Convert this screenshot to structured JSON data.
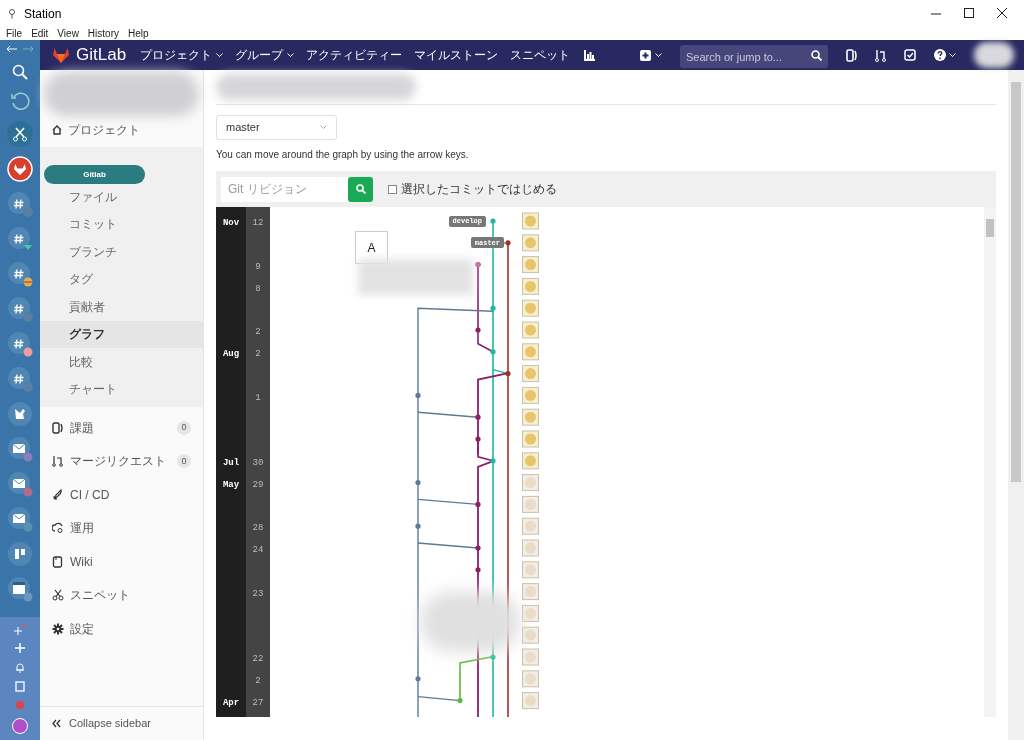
{
  "window": {
    "title": "Station"
  },
  "menu": [
    "File",
    "Edit",
    "View",
    "History",
    "Help"
  ],
  "navbar": {
    "logo": "GitLab",
    "items": [
      {
        "label": "プロジェクト",
        "dropdown": true
      },
      {
        "label": "グループ",
        "dropdown": true
      },
      {
        "label": "アクティビティー",
        "dropdown": false
      },
      {
        "label": "マイルストーン",
        "dropdown": false
      },
      {
        "label": "スニペット",
        "dropdown": false
      }
    ],
    "search": {
      "placeholder": "Search or jump to..."
    }
  },
  "sidebar": {
    "project": "プロジェクト",
    "tooltip": "Gitlab",
    "repo_items": [
      {
        "label": "ファイル",
        "selected": false
      },
      {
        "label": "コミット",
        "selected": false
      },
      {
        "label": "ブランチ",
        "selected": false
      },
      {
        "label": "タグ",
        "selected": false
      },
      {
        "label": "貢献者",
        "selected": false
      },
      {
        "label": "グラフ",
        "selected": true
      },
      {
        "label": "比較",
        "selected": false
      },
      {
        "label": "チャート",
        "selected": false
      }
    ],
    "items": [
      {
        "label": "課題",
        "count": "0"
      },
      {
        "label": "マージリクエスト",
        "count": "0"
      },
      {
        "label": "CI / CD"
      },
      {
        "label": "運用"
      },
      {
        "label": "Wiki"
      },
      {
        "label": "スニペット"
      },
      {
        "label": "設定"
      }
    ],
    "collapse": "Collapse sidebar"
  },
  "branch_select": {
    "value": "master"
  },
  "hint": "You can move around the graph by using the arrow keys.",
  "revision": {
    "placeholder": "Git リビジョン"
  },
  "start_checkbox": {
    "label": "選択したコミットではじめる",
    "checked": false
  },
  "graph": {
    "tooltip": "A",
    "labels": [
      {
        "text": "develop"
      },
      {
        "text": "master"
      }
    ],
    "rows": [
      {
        "month": "Nov",
        "day": "12"
      },
      {},
      {
        "day": "9"
      },
      {
        "day": "8"
      },
      {},
      {
        "day": "2"
      },
      {
        "month": "Aug",
        "day": "2"
      },
      {},
      {
        "day": "1"
      },
      {},
      {},
      {
        "month": "Jul",
        "day": "30"
      },
      {
        "month": "May",
        "day": "29"
      },
      {},
      {
        "day": "28"
      },
      {
        "day": "24"
      },
      {},
      {
        "day": "23"
      },
      {},
      {},
      {
        "day": "22"
      },
      {
        "day": "2"
      },
      {
        "month": "Apr",
        "day": "27"
      }
    ]
  }
}
